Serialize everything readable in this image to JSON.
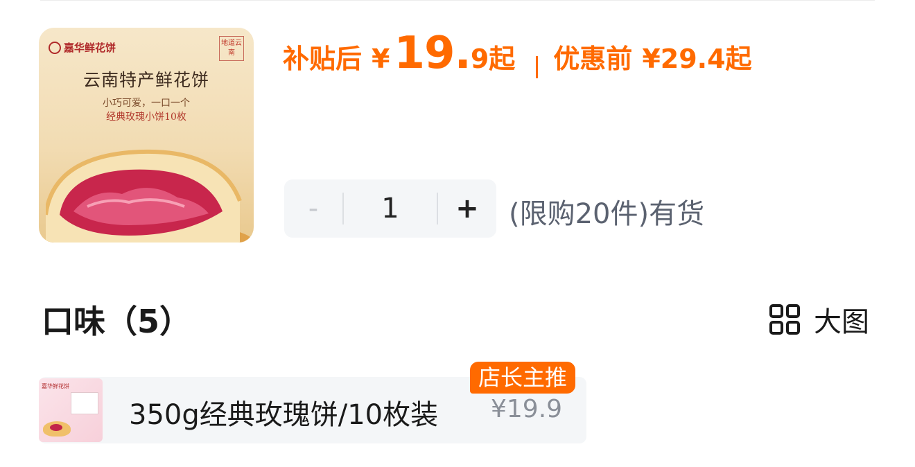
{
  "product": {
    "image": {
      "brand": "嘉华鲜花饼",
      "stamp": "地道云南",
      "title": "云南特产鲜花饼",
      "sub1": "小巧可爱，一口一个",
      "sub2": "经典玫瑰小饼10枚"
    }
  },
  "price": {
    "subsidy_label": "补贴后",
    "currency": "¥",
    "big": "19.",
    "small": "9起",
    "original_label": "优惠前",
    "original_value": "¥29.4起",
    "color": "#ff6a00"
  },
  "quantity": {
    "minus": "-",
    "value": "1",
    "plus": "+",
    "stock_text": "(限购20件)有货"
  },
  "flavor": {
    "title": "口味（5）",
    "view_toggle": "大图"
  },
  "sku": {
    "badge": "店长主推",
    "thumb_brand": "嘉华鲜花饼",
    "label": "350g经典玫瑰饼/10枚装",
    "price": "¥19.9"
  }
}
